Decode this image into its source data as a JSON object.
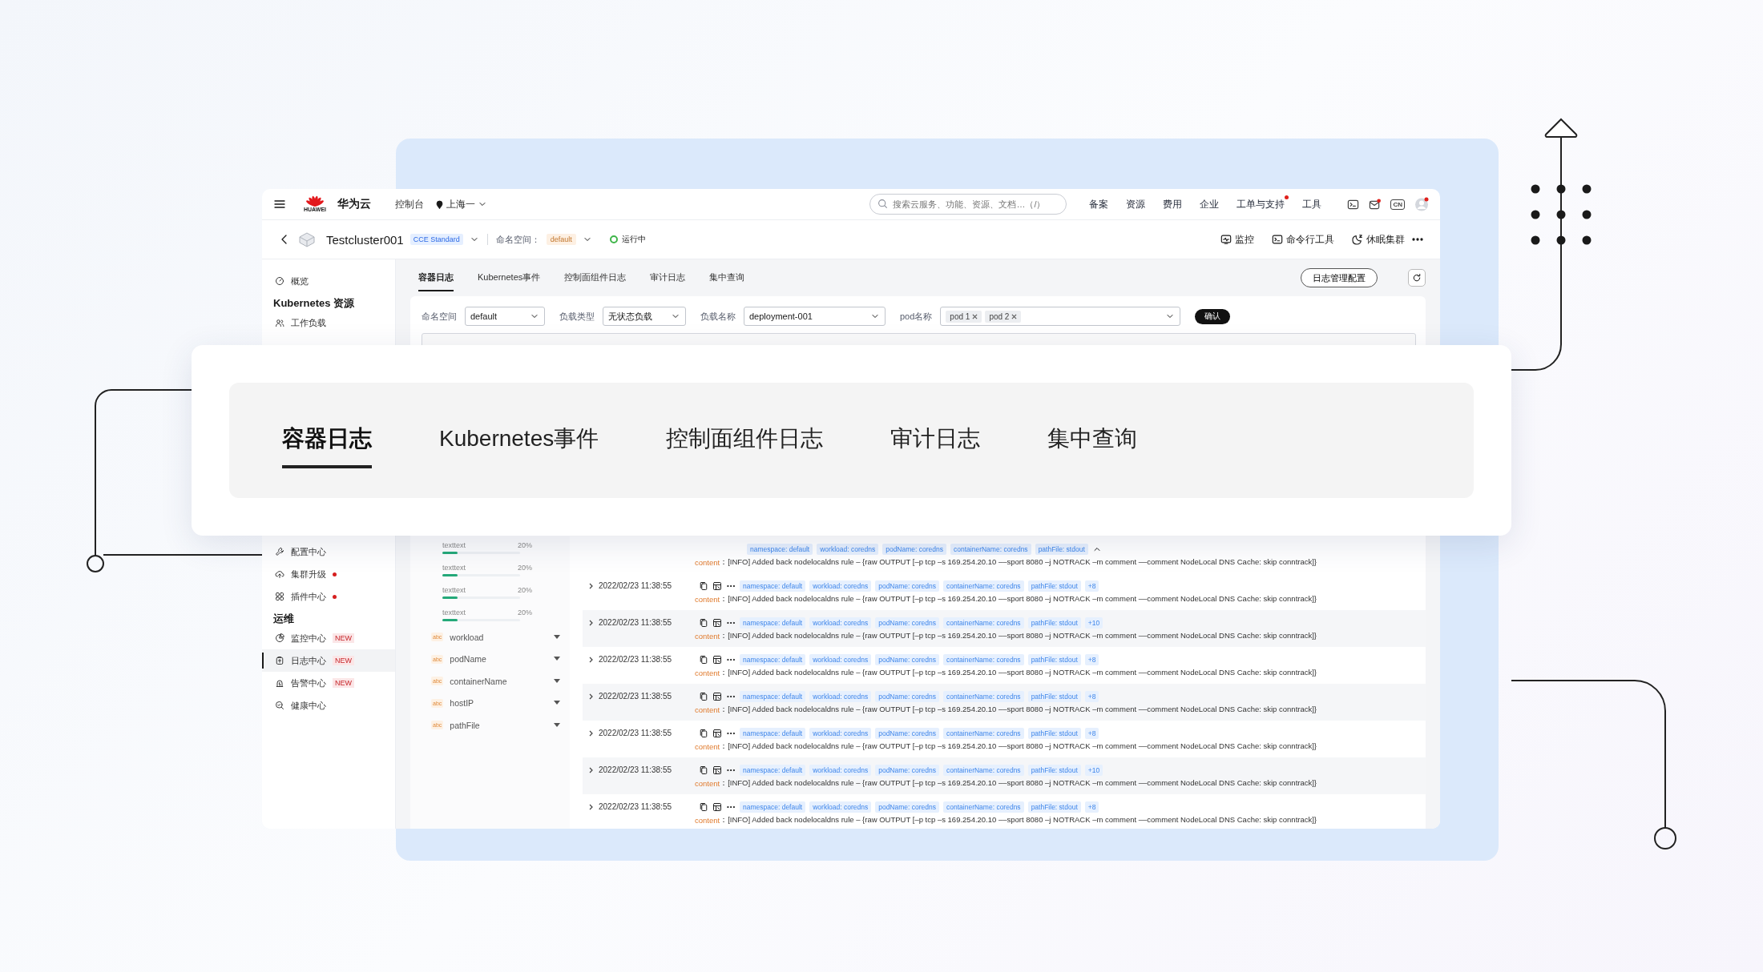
{
  "topbar": {
    "brand_mark": "HUAWEI",
    "brand": "华为云",
    "console": "控制台",
    "region": "上海一",
    "search": {
      "placeholder": "搜索云服务、功能、资源、文档…（/）"
    },
    "menu": [
      {
        "label": "备案",
        "dot": false
      },
      {
        "label": "资源",
        "dot": false
      },
      {
        "label": "费用",
        "dot": false
      },
      {
        "label": "企业",
        "dot": false
      },
      {
        "label": "工单与支持",
        "dot": true
      },
      {
        "label": "工具",
        "dot": false
      }
    ],
    "language": "CN"
  },
  "cluster_bar": {
    "name": "Testcluster001",
    "edition": "CCE Standard",
    "namespace_label": "命名空间：",
    "namespace": "default",
    "status": "运行中",
    "actions": [
      "监控",
      "命令行工具",
      "休眠集群"
    ]
  },
  "sidebar": {
    "sections": [
      {
        "items": [
          {
            "label": "概览",
            "selected": false,
            "dot": false
          }
        ]
      },
      {
        "title": "Kubernetes 资源",
        "items": [
          {
            "label": "工作负载",
            "selected": false,
            "dot": false
          }
        ]
      },
      {
        "items": [
          {
            "label": "配置中心",
            "selected": false,
            "dot": false
          },
          {
            "label": "集群升级",
            "selected": false,
            "dot": true
          },
          {
            "label": "插件中心",
            "selected": false,
            "dot": true
          }
        ]
      },
      {
        "title": "运维",
        "items": [
          {
            "label": "监控中心",
            "selected": false,
            "dot": false,
            "badge": "NEW"
          },
          {
            "label": "日志中心",
            "selected": true,
            "dot": false,
            "badge": "NEW"
          },
          {
            "label": "告警中心",
            "selected": false,
            "dot": false,
            "badge": "NEW"
          },
          {
            "label": "健康中心",
            "selected": false,
            "dot": false
          }
        ]
      }
    ]
  },
  "log_tabs": [
    {
      "label": "容器日志",
      "selected": true
    },
    {
      "label": "Kubernetes事件",
      "selected": false
    },
    {
      "label": "控制面组件日志",
      "selected": false
    },
    {
      "label": "审计日志",
      "selected": false
    },
    {
      "label": "集中查询",
      "selected": false
    }
  ],
  "config_button": "日志管理配置",
  "filters": [
    {
      "label": "命名空间",
      "value": "default"
    },
    {
      "label": "负载类型",
      "value": "无状态负载"
    },
    {
      "label": "负载名称",
      "value": "deployment-001"
    },
    {
      "label": "pod名称",
      "chips": [
        "pod 1",
        "pod 2"
      ]
    }
  ],
  "confirm_button": "确认",
  "distribution": [
    {
      "label": "texttext",
      "percent": "20%",
      "level": 0.2
    },
    {
      "label": "texttext",
      "percent": "20%",
      "level": 0.2
    },
    {
      "label": "texttext",
      "percent": "20%",
      "level": 0.2
    },
    {
      "label": "texttext",
      "percent": "20%",
      "level": 0.2
    }
  ],
  "fields": [
    {
      "type_tag": "abc",
      "name": "workload"
    },
    {
      "type_tag": "abc",
      "name": "podName"
    },
    {
      "type_tag": "abc",
      "name": "containerName"
    },
    {
      "type_tag": "abc",
      "name": "hostIP"
    },
    {
      "type_tag": "abc",
      "name": "pathFile"
    }
  ],
  "logs": [
    {
      "kind": "continued",
      "tags": [
        "namespace: default",
        "workload: coredns",
        "podName: coredns",
        "containerName: coredns",
        "pathFile: stdout"
      ],
      "content_label": "content",
      "content": "：[INFO] Added back nodelocaldns rule – {raw OUTPUT [–p tcp –s 169.254.20.10 ––sport 8080 –j NOTRACK –m comment ––comment NodeLocal DNS Cache: skip conntrack]}"
    },
    {
      "kind": "entry",
      "expanded": false,
      "date": "2022/02/23 11:38:55",
      "tags": [
        "namespace: default",
        "workload: coredns",
        "podName: coredns",
        "containerName: coredns",
        "pathFile: stdout"
      ],
      "more": "+8",
      "content_label": "content",
      "content": "：[INFO] Added back nodelocaldns rule – {raw OUTPUT [–p tcp –s 169.254.20.10 ––sport 8080 –j NOTRACK –m comment ––comment NodeLocal DNS Cache: skip conntrack]}"
    },
    {
      "kind": "entry",
      "expanded": false,
      "date": "2022/02/23 11:38:55",
      "tags": [
        "namespace: default",
        "workload: coredns",
        "podName: coredns",
        "containerName: coredns",
        "pathFile: stdout"
      ],
      "more": "+10",
      "content_label": "content",
      "content": "：[INFO] Added back nodelocaldns rule – {raw OUTPUT [–p tcp –s 169.254.20.10 ––sport 8080 –j NOTRACK –m comment ––comment NodeLocal DNS Cache: skip conntrack]}"
    },
    {
      "kind": "entry",
      "expanded": false,
      "date": "2022/02/23 11:38:55",
      "tags": [
        "namespace: default",
        "workload: coredns",
        "podName: coredns",
        "containerName: coredns",
        "pathFile: stdout"
      ],
      "more": "+8",
      "content_label": "content",
      "content": "：[INFO] Added back nodelocaldns rule – {raw OUTPUT [–p tcp –s 169.254.20.10 ––sport 8080 –j NOTRACK –m comment ––comment NodeLocal DNS Cache: skip conntrack]}"
    },
    {
      "kind": "entry",
      "expanded": false,
      "date": "2022/02/23 11:38:55",
      "tags": [
        "namespace: default",
        "workload: coredns",
        "podName: coredns",
        "containerName: coredns",
        "pathFile: stdout"
      ],
      "more": "+8",
      "content_label": "content",
      "content": "：[INFO] Added back nodelocaldns rule – {raw OUTPUT [–p tcp –s 169.254.20.10 ––sport 8080 –j NOTRACK –m comment ––comment NodeLocal DNS Cache: skip conntrack]}"
    },
    {
      "kind": "entry",
      "expanded": false,
      "date": "2022/02/23 11:38:55",
      "tags": [
        "namespace: default",
        "workload: coredns",
        "podName: coredns",
        "containerName: coredns",
        "pathFile: stdout"
      ],
      "more": "+8",
      "content_label": "content",
      "content": "：[INFO] Added back nodelocaldns rule – {raw OUTPUT [–p tcp –s 169.254.20.10 ––sport 8080 –j NOTRACK –m comment ––comment NodeLocal DNS Cache: skip conntrack]}"
    },
    {
      "kind": "entry",
      "expanded": false,
      "date": "2022/02/23 11:38:55",
      "tags": [
        "namespace: default",
        "workload: coredns",
        "podName: coredns",
        "containerName: coredns",
        "pathFile: stdout"
      ],
      "more": "+10",
      "content_label": "content",
      "content": "：[INFO] Added back nodelocaldns rule – {raw OUTPUT [–p tcp –s 169.254.20.10 ––sport 8080 –j NOTRACK –m comment ––comment NodeLocal DNS Cache: skip conntrack]}"
    },
    {
      "kind": "entry",
      "expanded": false,
      "date": "2022/02/23 11:38:55",
      "tags": [
        "namespace: default",
        "workload: coredns",
        "podName: coredns",
        "containerName: coredns",
        "pathFile: stdout"
      ],
      "more": "+8",
      "content_label": "content",
      "content": "：[INFO] Added back nodelocaldns rule – {raw OUTPUT [–p tcp –s 169.254.20.10 ––sport 8080 –j NOTRACK –m comment ––comment NodeLocal DNS Cache: skip conntrack]}"
    }
  ],
  "overlay": {
    "tabs": [
      {
        "label": "容器日志",
        "selected": true
      },
      {
        "label": "Kubernetes事件",
        "selected": false
      },
      {
        "label": "控制面组件日志",
        "selected": false
      },
      {
        "label": "审计日志",
        "selected": false
      },
      {
        "label": "集中查询",
        "selected": false
      }
    ]
  }
}
